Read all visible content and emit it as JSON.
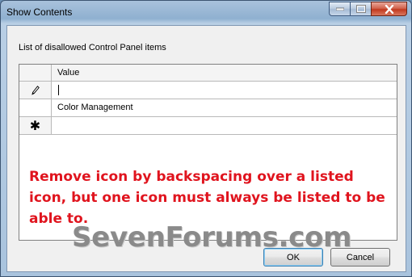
{
  "window": {
    "title": "Show Contents"
  },
  "dialog": {
    "instruction": "List of disallowed Control Panel items",
    "grid": {
      "column_header": "Value",
      "rows": [
        {
          "value": "",
          "state": "editing"
        },
        {
          "value": "Color Management",
          "state": "normal"
        },
        {
          "value": "",
          "state": "new-row"
        }
      ]
    },
    "note": "Remove icon by backspacing over a listed icon, but one icon must always be listed to be able to.",
    "buttons": {
      "ok": "OK",
      "cancel": "Cancel"
    }
  },
  "watermark": {
    "text": "SevenForums.com"
  },
  "colors": {
    "note": "#e0141e",
    "title_bar": "#8fb0d0",
    "close_button": "#c2391f"
  },
  "icons": {
    "edit_row": "pencil-icon",
    "new_row": "asterisk-icon"
  }
}
